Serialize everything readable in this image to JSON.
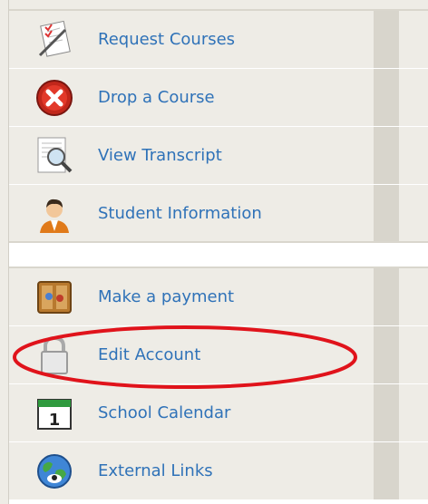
{
  "menu": {
    "items": [
      {
        "label": "Request Courses",
        "icon": "request-courses-icon"
      },
      {
        "label": "Drop a Course",
        "icon": "drop-course-icon"
      },
      {
        "label": "View Transcript",
        "icon": "transcript-icon"
      },
      {
        "label": "Student Information",
        "icon": "student-icon"
      },
      {
        "label": "Make a payment",
        "icon": "wallet-icon"
      },
      {
        "label": "Edit Account",
        "icon": "lock-icon"
      },
      {
        "label": "School Calendar",
        "icon": "calendar-icon"
      },
      {
        "label": "External Links",
        "icon": "globe-icon"
      }
    ]
  },
  "colors": {
    "link": "#2f72b8",
    "row_bg": "#eeece6",
    "annotation": "#e0131b"
  }
}
